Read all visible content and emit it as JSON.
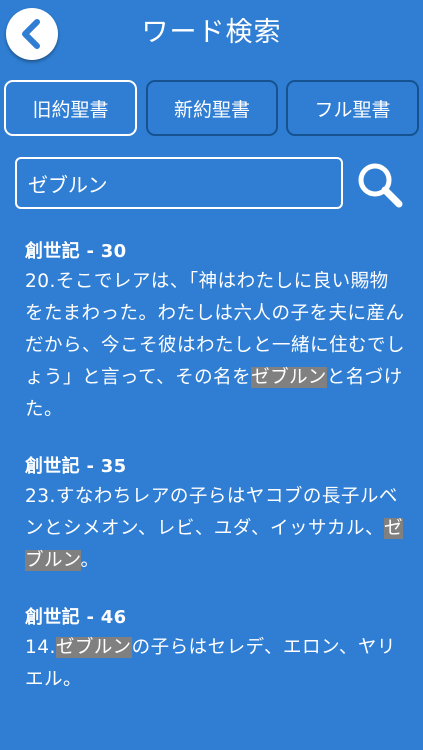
{
  "header": {
    "title": "ワード検索"
  },
  "tabs": [
    {
      "label": "旧約聖書",
      "active": true
    },
    {
      "label": "新約聖書",
      "active": false
    },
    {
      "label": "フル聖書",
      "active": false
    }
  ],
  "search": {
    "value": "ゼブルン"
  },
  "results": [
    {
      "ref": "創世記 - 30",
      "prefix": "20.そこでレアは、「神はわたしに良い賜物をたまわった。わたしは六人の子を夫に産んだから、今こそ彼はわたしと一緒に住むでしょう」と言って、その名を",
      "match": "ゼブルン",
      "suffix": "と名づけた。"
    },
    {
      "ref": "創世記 - 35",
      "prefix": "23.すなわちレアの子らはヤコブの長子ルベンとシメオン、レビ、ユダ、イッサカル、",
      "match": "ゼブルン",
      "suffix": "。"
    },
    {
      "ref": "創世記 - 46",
      "prefix": "14.",
      "match": "ゼブルン",
      "suffix": "の子らはセレデ、エロン、ヤリエル。"
    }
  ],
  "colors": {
    "background": "#2f7ed3",
    "tab_border": "#16528f",
    "highlight": "#808080"
  },
  "icons": {
    "back": "chevron-left-icon",
    "search": "search-icon"
  }
}
